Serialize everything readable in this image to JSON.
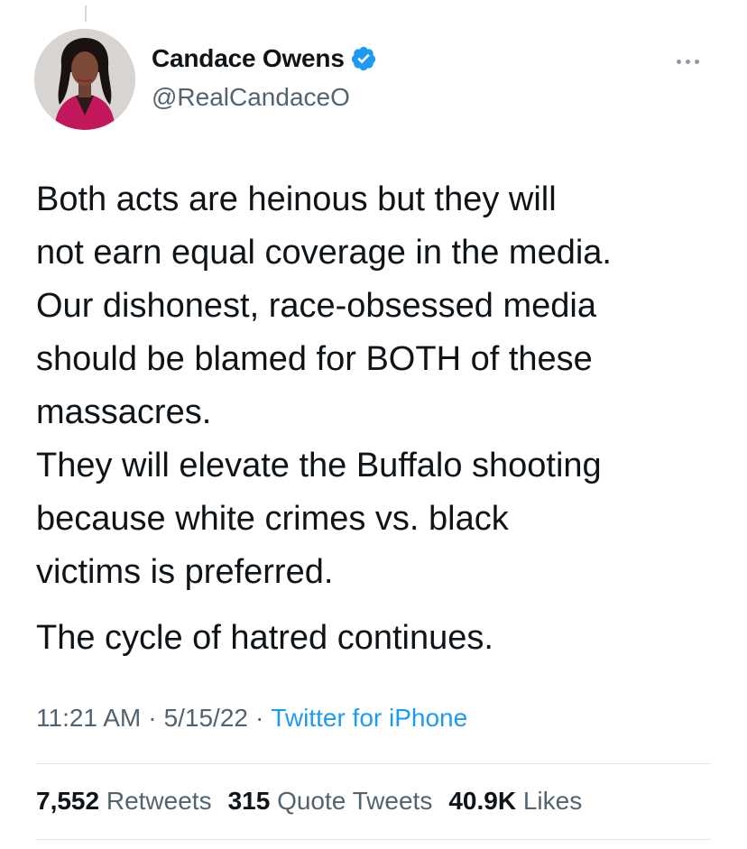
{
  "author": {
    "display_name": "Candace Owens",
    "handle": "@RealCandaceO",
    "verified": true,
    "verified_icon": "verified-badge-icon",
    "accent_color": "#1d9bf0"
  },
  "tweet": {
    "paragraph_1": "Both acts are heinous but they will\nnot earn equal coverage in the media.\nOur dishonest, race-obsessed media\nshould be blamed for BOTH of these\nmassacres.\nThey will elevate the Buffalo shooting\nbecause white crimes vs. black\nvictims is preferred.",
    "paragraph_2": "The cycle of hatred continues."
  },
  "meta": {
    "time": "11:21 AM",
    "date": "5/15/22",
    "separator": "·",
    "source": "Twitter for iPhone"
  },
  "stats": {
    "retweets_count": "7,552",
    "retweets_label": "Retweets",
    "quote_count": "315",
    "quote_label": "Quote Tweets",
    "likes_count": "40.9K",
    "likes_label": "Likes"
  },
  "more_icon": "more-options-icon"
}
